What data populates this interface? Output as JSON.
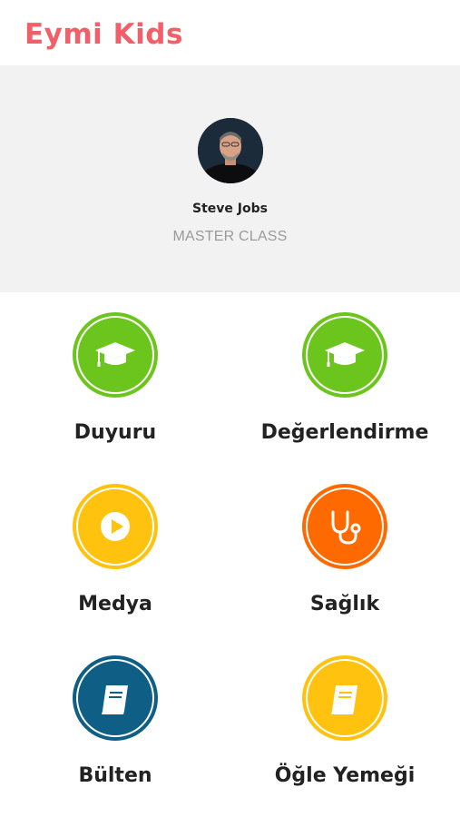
{
  "app": {
    "title": "Eymi Kids",
    "brand_color": "#f25f69"
  },
  "profile": {
    "name": "Steve Jobs",
    "role": "MASTER CLASS"
  },
  "menu": {
    "items": [
      {
        "label": "Duyuru",
        "icon": "graduation-cap-icon",
        "color": "#6cc51c"
      },
      {
        "label": "Değerlendirme",
        "icon": "graduation-cap-icon",
        "color": "#6cc51c"
      },
      {
        "label": "Medya",
        "icon": "play-icon",
        "color": "#ffc20e"
      },
      {
        "label": "Sağlık",
        "icon": "stethoscope-icon",
        "color": "#ff6a00"
      },
      {
        "label": "Bülten",
        "icon": "book-icon",
        "color": "#0f5e85"
      },
      {
        "label": "Öğle Yemeği",
        "icon": "book-icon",
        "color": "#ffc20e"
      }
    ]
  }
}
